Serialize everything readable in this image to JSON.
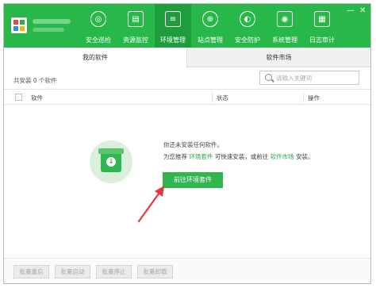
{
  "nav": {
    "items": [
      {
        "label": "安全巡检",
        "icon": "radar-icon",
        "glyph": "◎"
      },
      {
        "label": "资源监控",
        "icon": "monitor-chart-icon",
        "glyph": "▤"
      },
      {
        "label": "环境管理",
        "icon": "server-stack-icon",
        "glyph": "≡"
      },
      {
        "label": "站点管理",
        "icon": "globe-icon",
        "glyph": "⊕"
      },
      {
        "label": "安全防护",
        "icon": "shield-icon",
        "glyph": "◐"
      },
      {
        "label": "系统管理",
        "icon": "display-settings-icon",
        "glyph": "◉"
      },
      {
        "label": "日志审计",
        "icon": "document-log-icon",
        "glyph": "▦"
      }
    ],
    "active_index": 2
  },
  "window_controls": {
    "minimize": "—",
    "close": "✕"
  },
  "tabs": {
    "my_software": "我的软件",
    "software_market": "软件市场",
    "active": "my_software"
  },
  "toolbar": {
    "count_text": "共安装 0 个软件",
    "search_placeholder": "请输入关键词"
  },
  "table": {
    "columns": {
      "software": "软件",
      "status": "状态",
      "action": "操作"
    }
  },
  "empty_state": {
    "line1": "你还未安装任何软件。",
    "line2_prefix": "为您推荐 ",
    "line2_link1": "环境套件",
    "line2_middle": " 可快速安装，或前往 ",
    "line2_link2": "软件市场",
    "line2_suffix": " 安装。",
    "button_label": "前往环境套件",
    "icon_glyph": "↓"
  },
  "footer": {
    "buttons": [
      "批量重启",
      "批量启动",
      "批量停止",
      "批量卸载"
    ]
  },
  "colors": {
    "brand": "#28b84a",
    "annotation_arrow": "#e8363a"
  }
}
